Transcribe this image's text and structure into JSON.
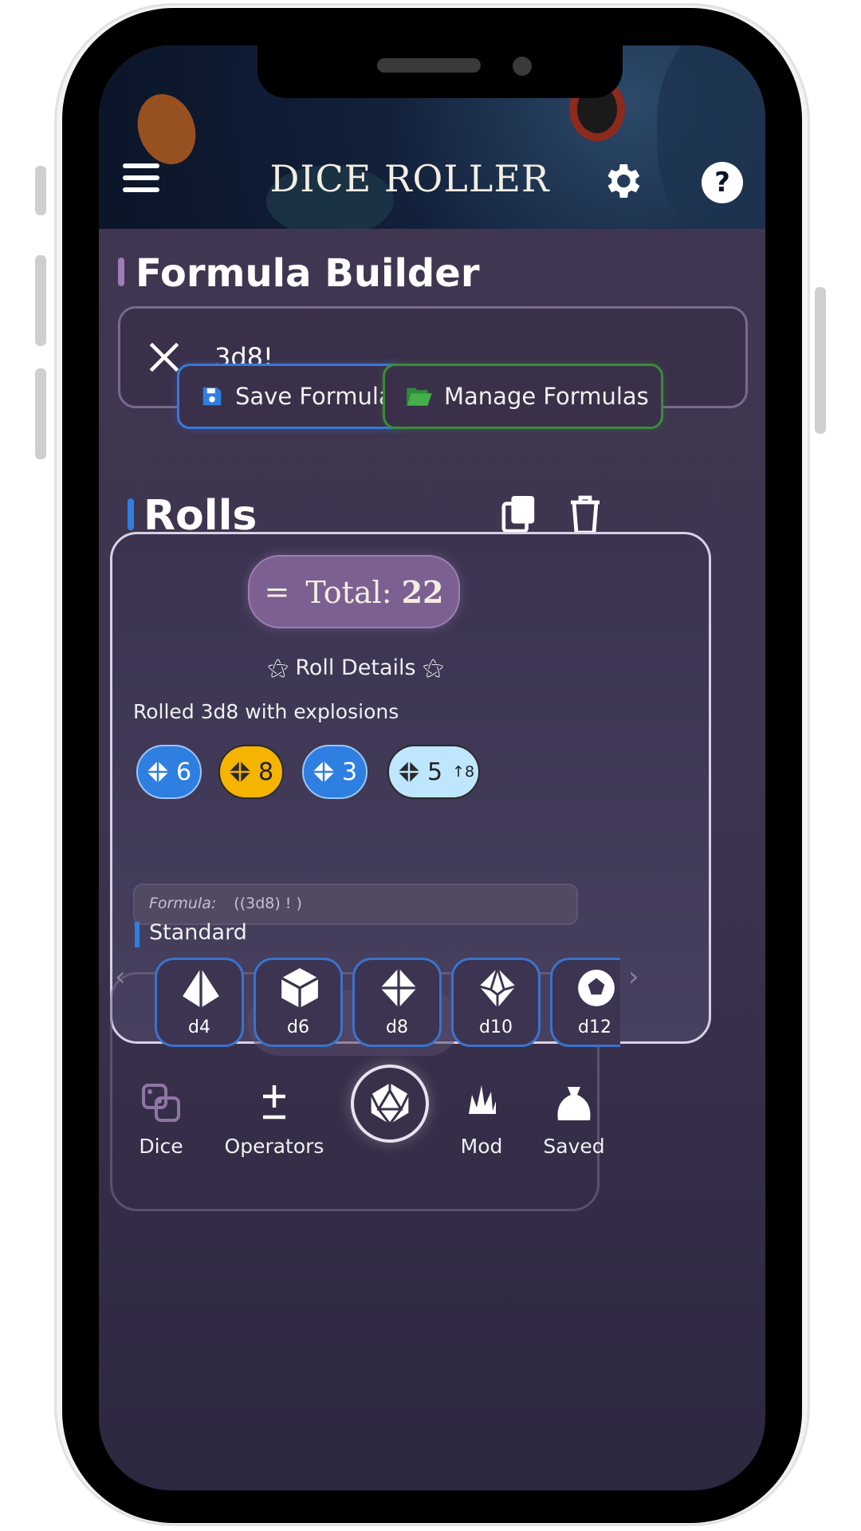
{
  "header": {
    "title": "DICE ROLLER",
    "help_label": "?"
  },
  "formula_builder": {
    "title": "Formula Builder",
    "input_value": "3d8!",
    "save_label": "Save Formula",
    "manage_label": "Manage Formulas"
  },
  "rolls": {
    "title": "Rolls",
    "total_symbol": "=",
    "total_label": "Total:",
    "total_value": "22",
    "details_title": "Roll Details",
    "description": "Rolled 3d8 with explosions",
    "dice": [
      {
        "value": "6",
        "style": "blue"
      },
      {
        "value": "8",
        "style": "gold"
      },
      {
        "value": "3",
        "style": "blue"
      },
      {
        "value": "5",
        "style": "light",
        "explode": "↑8"
      }
    ],
    "formula_label": "Formula:",
    "formula_value": "((3d8) ! )",
    "category_label": "Standard"
  },
  "dice_selector": {
    "items": [
      "d4",
      "d6",
      "d8",
      "d10",
      "d12"
    ]
  },
  "bottom_nav": {
    "dice": "Dice",
    "operators": "Operators",
    "mod": "Mod",
    "saved": "Saved"
  },
  "colors": {
    "accent_blue": "#2f7fe0",
    "gold": "#f5b400",
    "purple_pill": "#7c6092"
  }
}
